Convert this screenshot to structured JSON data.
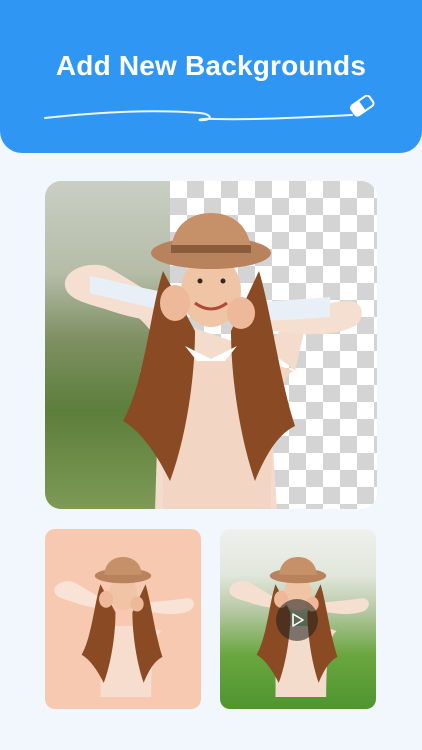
{
  "header": {
    "title": "Add New Backgrounds",
    "accent_color": "#2f96f3",
    "decoration_icon": "eraser-icon"
  },
  "hero": {
    "icons": [
      "hat-icon"
    ],
    "left_background": "photo",
    "right_background": "transparent-checkerboard"
  },
  "cards": [
    {
      "background": "peach",
      "color": "#f7c9b1"
    },
    {
      "background": "nature",
      "overlay_icon": "play-icon"
    }
  ]
}
